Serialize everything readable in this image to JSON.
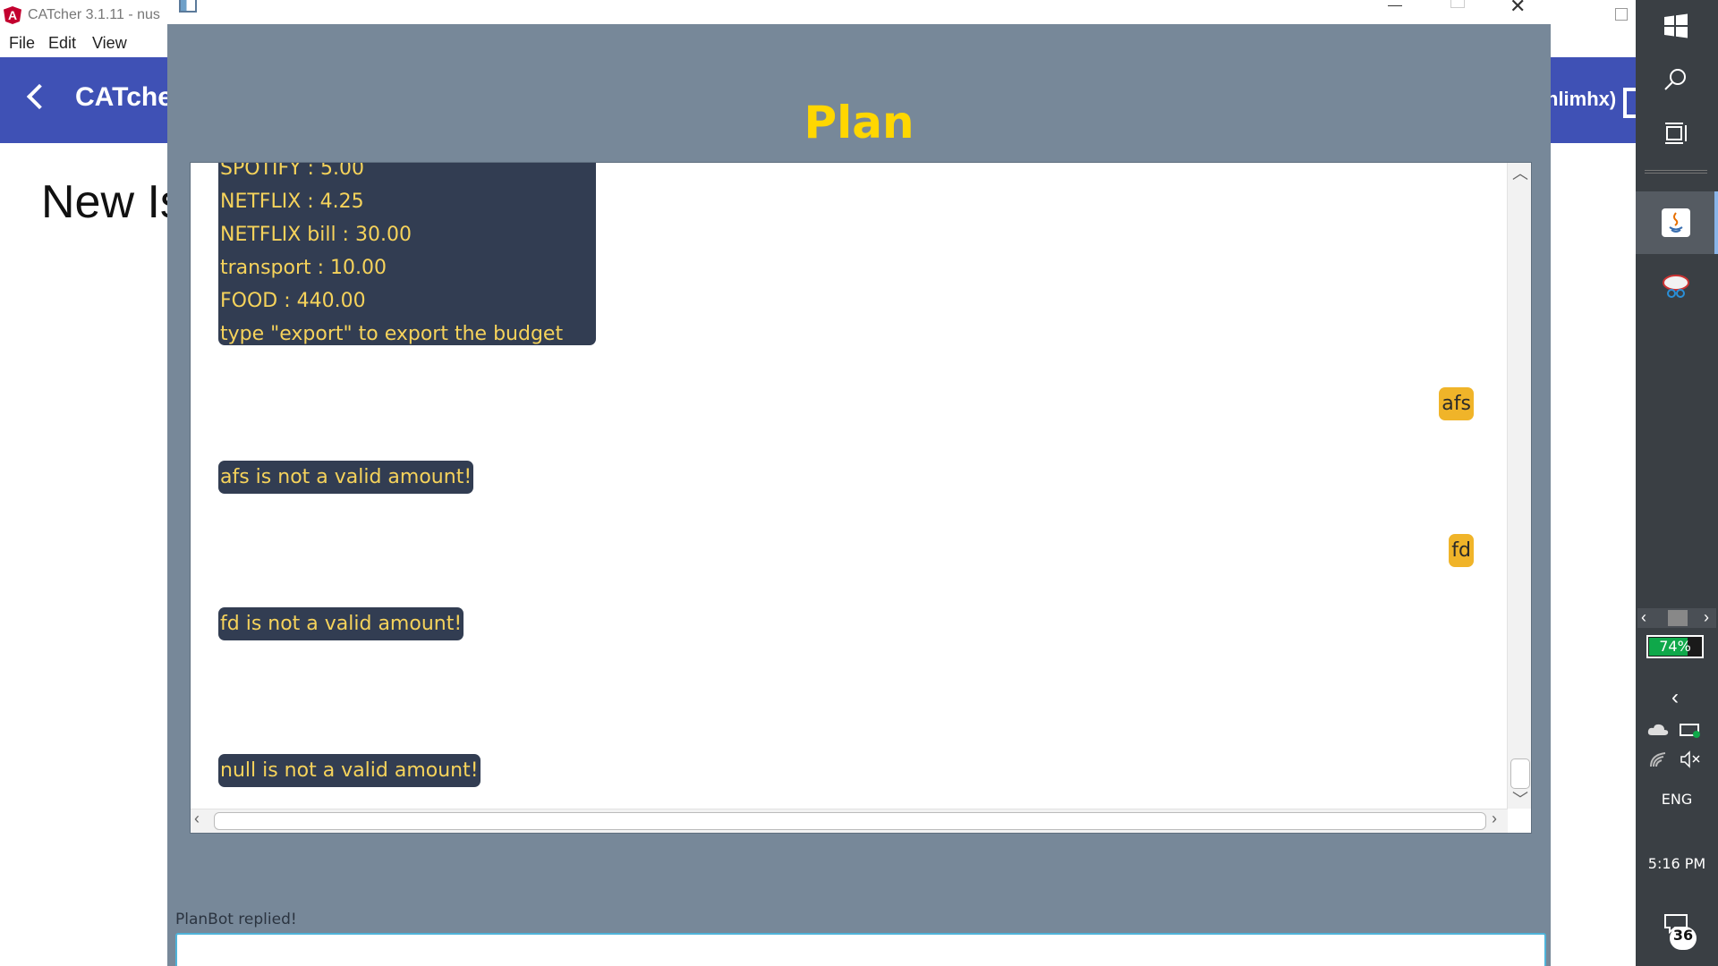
{
  "background_window": {
    "title": "CATcher 3.1.11 - nus",
    "menu": [
      "File",
      "Edit",
      "View"
    ],
    "app_title": "CATcher",
    "user_fragment": "nlimhx)",
    "page_title": "New Is"
  },
  "app_window": {
    "heading": "Plan",
    "messages": {
      "budget_lines": [
        "SPOTIFY : 5.00",
        "NETFLIX : 4.25",
        "NETFLIX bill : 30.00",
        "transport : 10.00",
        "FOOD : 440.00",
        "type \"export\" to export the budget"
      ],
      "user_afs": "afs",
      "bot_afs": "afs is not a valid amount!",
      "user_fd": "fd",
      "bot_fd": "fd is not a valid amount!",
      "bot_null": "null is not a valid amount!"
    },
    "status_text": "PlanBot replied!",
    "input_value": ""
  },
  "taskbar": {
    "battery_percent": 74,
    "battery_label": "74%",
    "language": "ENG",
    "clock": "5:16 PM",
    "notification_count": "36",
    "colors": {
      "battery": "#0fa84a",
      "accent": "#8ab4e8"
    }
  }
}
